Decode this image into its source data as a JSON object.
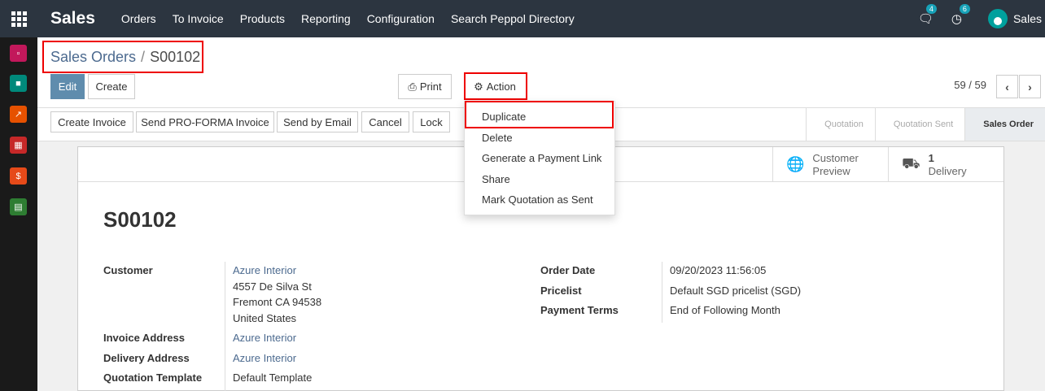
{
  "navbar": {
    "brand": "Sales",
    "menu": [
      "Orders",
      "To Invoice",
      "Products",
      "Reporting",
      "Configuration",
      "Search Peppol Directory"
    ],
    "messages_count": "4",
    "activities_count": "6",
    "user_name": "Sales"
  },
  "sidebar": {
    "icons": [
      {
        "name": "discuss-icon",
        "color": "#c2185b"
      },
      {
        "name": "contacts-icon",
        "color": "#00897b"
      },
      {
        "name": "dashboard-icon",
        "color": "#e65100"
      },
      {
        "name": "inventory-icon",
        "color": "#c62828"
      },
      {
        "name": "invoicing-icon",
        "color": "#e64a19"
      },
      {
        "name": "documents-icon",
        "color": "#2e7d32"
      }
    ]
  },
  "breadcrumb": {
    "parent": "Sales Orders",
    "separator": "/",
    "current": "S00102"
  },
  "control_panel": {
    "edit_label": "Edit",
    "create_label": "Create",
    "print_label": "Print",
    "action_label": "Action",
    "pager_value": "59 / 59"
  },
  "action_menu": {
    "items": [
      "Duplicate",
      "Delete",
      "Generate a Payment Link",
      "Share",
      "Mark Quotation as Sent"
    ]
  },
  "statusbar": {
    "buttons": [
      "Create Invoice",
      "Send PRO-FORMA Invoice",
      "Send by Email",
      "Cancel",
      "Lock"
    ],
    "stages": [
      "Quotation",
      "Quotation Sent",
      "Sales Order"
    ],
    "active_stage": "Sales Order"
  },
  "smart_buttons": {
    "customer_preview_line1": "Customer",
    "customer_preview_line2": "Preview",
    "delivery_count": "1",
    "delivery_label": "Delivery"
  },
  "form": {
    "title": "S00102",
    "customer_label": "Customer",
    "customer_name": "Azure Interior",
    "customer_address": [
      "4557 De Silva St",
      "Fremont CA 94538",
      "United States"
    ],
    "invoice_address_label": "Invoice Address",
    "invoice_address": "Azure Interior",
    "delivery_address_label": "Delivery Address",
    "delivery_address": "Azure Interior",
    "quotation_template_label": "Quotation Template",
    "quotation_template": "Default Template",
    "order_date_label": "Order Date",
    "order_date": "09/20/2023 11:56:05",
    "pricelist_label": "Pricelist",
    "pricelist": "Default SGD pricelist (SGD)",
    "payment_terms_label": "Payment Terms",
    "payment_terms": "End of Following Month"
  }
}
